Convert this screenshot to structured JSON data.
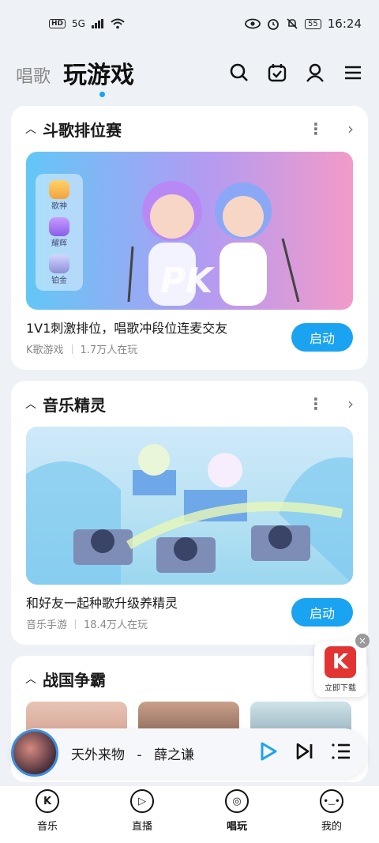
{
  "status": {
    "time": "16:24",
    "network": "5G",
    "battery": "55",
    "hd": "HD"
  },
  "top_nav": {
    "tab_sing": "唱歌",
    "tab_games": "玩游戏"
  },
  "cards": [
    {
      "title": "斗歌排位赛",
      "description": "1V1刺激排位，唱歌冲段位连麦交友",
      "category": "K歌游戏",
      "players": "1.7万人在玩",
      "button": "启动",
      "ranks": [
        "歌神",
        "耀辉",
        "铂金"
      ],
      "banner_text": "PK"
    },
    {
      "title": "音乐精灵",
      "description": "和好友一起种歌升级养精灵",
      "category": "音乐手游",
      "players": "18.4万人在玩",
      "button": "启动"
    },
    {
      "title": "战国争霸"
    }
  ],
  "player": {
    "song": "天外来物",
    "separator": "-",
    "artist": "薛之谦"
  },
  "bottom_nav": [
    {
      "label": "音乐",
      "glyph": "K",
      "active": false
    },
    {
      "label": "直播",
      "glyph": "▷",
      "active": false
    },
    {
      "label": "唱玩",
      "glyph": "◎",
      "active": true
    },
    {
      "label": "我的",
      "glyph": "•‿•",
      "active": false
    }
  ],
  "float_ad": {
    "text": "立即下载",
    "logo": "K",
    "close": "×"
  },
  "colors": {
    "accent": "#1aa3f0",
    "ad": "#e33434"
  }
}
